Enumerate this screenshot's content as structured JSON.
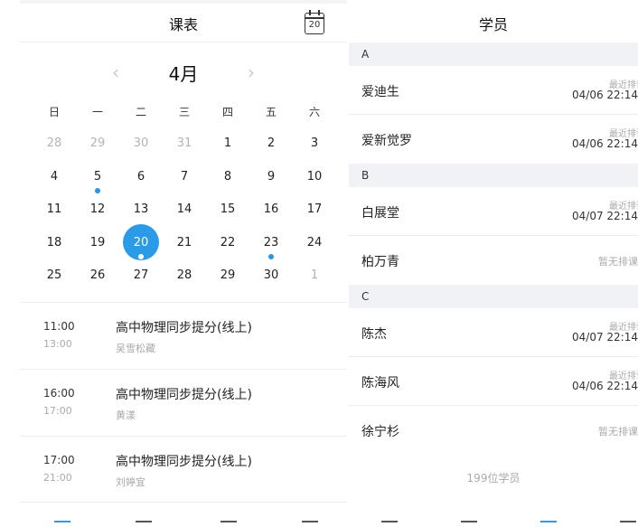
{
  "schedule": {
    "title": "课表",
    "calendar_button_day": "20",
    "month": "4月",
    "prev": "‹",
    "next": "›",
    "weekdays": [
      "日",
      "一",
      "二",
      "三",
      "四",
      "五",
      "六"
    ],
    "days": [
      {
        "d": "28",
        "muted": true
      },
      {
        "d": "29",
        "muted": true
      },
      {
        "d": "30",
        "muted": true
      },
      {
        "d": "31",
        "muted": true
      },
      {
        "d": "1"
      },
      {
        "d": "2"
      },
      {
        "d": "3"
      },
      {
        "d": "4"
      },
      {
        "d": "5",
        "dot": true
      },
      {
        "d": "6"
      },
      {
        "d": "7"
      },
      {
        "d": "8"
      },
      {
        "d": "9"
      },
      {
        "d": "10"
      },
      {
        "d": "11"
      },
      {
        "d": "12"
      },
      {
        "d": "13"
      },
      {
        "d": "14"
      },
      {
        "d": "15"
      },
      {
        "d": "16"
      },
      {
        "d": "17"
      },
      {
        "d": "18"
      },
      {
        "d": "19"
      },
      {
        "d": "20",
        "today": true,
        "dot": true
      },
      {
        "d": "21"
      },
      {
        "d": "22"
      },
      {
        "d": "23",
        "dot": true
      },
      {
        "d": "24"
      },
      {
        "d": "25"
      },
      {
        "d": "26"
      },
      {
        "d": "27"
      },
      {
        "d": "28"
      },
      {
        "d": "29"
      },
      {
        "d": "30"
      },
      {
        "d": "1",
        "muted": true
      }
    ],
    "lessons": [
      {
        "start": "11:00",
        "end": "13:00",
        "title": "高中物理同步提分(线上)",
        "teacher": "吴雪松藏"
      },
      {
        "start": "16:00",
        "end": "17:00",
        "title": "高中物理同步提分(线上)",
        "teacher": "黄漾"
      },
      {
        "start": "17:00",
        "end": "21:00",
        "title": "高中物理同步提分(线上)",
        "teacher": "刘婷宜"
      }
    ]
  },
  "students": {
    "title": "学员",
    "groups": [
      {
        "letter": "A",
        "items": [
          {
            "name": "爱迪生",
            "label": "最近排课",
            "time": "04/06 22:14"
          },
          {
            "name": "爱新觉罗",
            "label": "最近排课",
            "time": "04/06 22:14"
          }
        ]
      },
      {
        "letter": "B",
        "items": [
          {
            "name": "白展堂",
            "label": "最近排课",
            "time": "04/07 22:14"
          },
          {
            "name": "柏万青",
            "none": "暂无排课"
          }
        ]
      },
      {
        "letter": "C",
        "items": [
          {
            "name": "陈杰",
            "label": "最近排课",
            "time": "04/07 22:14"
          },
          {
            "name": "陈海风",
            "label": "最近排课",
            "time": "04/06 22:14"
          },
          {
            "name": "徐宁杉",
            "none": "暂无排课"
          }
        ]
      }
    ],
    "count": "199位学员"
  },
  "colors": {
    "accent": "#2b9be8",
    "section_bg": "#f1f2f5"
  }
}
